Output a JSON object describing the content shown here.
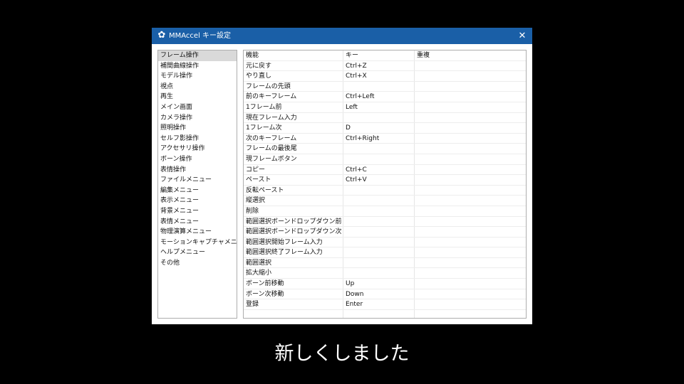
{
  "window": {
    "title": "MMAccel キー設定",
    "icon": "gear-icon",
    "close_label": "✕",
    "accent_color": "#1a5fa7"
  },
  "categories": {
    "selected_index": 0,
    "items": [
      "フレーム操作",
      "補間曲線操作",
      "モデル操作",
      "視点",
      "再生",
      "メイン画面",
      "カメラ操作",
      "照明操作",
      "セルフ影操作",
      "アクセサリ操作",
      "ボーン操作",
      "表情操作",
      "ファイルメニュー",
      "編集メニュー",
      "表示メニュー",
      "背景メニュー",
      "表情メニュー",
      "物理演算メニュー",
      "モーションキャプチャメニュー",
      "ヘルプメニュー",
      "その他"
    ]
  },
  "table": {
    "headers": {
      "function": "機能",
      "key": "キー",
      "duplicate": "重複"
    },
    "rows": [
      {
        "function": "元に戻す",
        "key": "Ctrl+Z",
        "duplicate": ""
      },
      {
        "function": "やり直し",
        "key": "Ctrl+X",
        "duplicate": ""
      },
      {
        "function": "フレームの先頭",
        "key": "",
        "duplicate": ""
      },
      {
        "function": "前のキーフレーム",
        "key": "Ctrl+Left",
        "duplicate": ""
      },
      {
        "function": "1フレーム前",
        "key": "Left",
        "duplicate": ""
      },
      {
        "function": "現在フレーム入力",
        "key": "",
        "duplicate": ""
      },
      {
        "function": "1フレーム次",
        "key": "D",
        "duplicate": ""
      },
      {
        "function": "次のキーフレーム",
        "key": "Ctrl+Right",
        "duplicate": ""
      },
      {
        "function": "フレームの最後尾",
        "key": "",
        "duplicate": ""
      },
      {
        "function": "現フレームボタン",
        "key": "",
        "duplicate": ""
      },
      {
        "function": "コピー",
        "key": "Ctrl+C",
        "duplicate": ""
      },
      {
        "function": "ペースト",
        "key": "Ctrl+V",
        "duplicate": ""
      },
      {
        "function": "反転ペースト",
        "key": "",
        "duplicate": ""
      },
      {
        "function": "縦選択",
        "key": "",
        "duplicate": ""
      },
      {
        "function": "削除",
        "key": "",
        "duplicate": ""
      },
      {
        "function": "範囲選択ボーンドロップダウン前項目",
        "key": "",
        "duplicate": ""
      },
      {
        "function": "範囲選択ボーンドロップダウン次項目",
        "key": "",
        "duplicate": ""
      },
      {
        "function": "範囲選択開始フレーム入力",
        "key": "",
        "duplicate": ""
      },
      {
        "function": "範囲選択終了フレーム入力",
        "key": "",
        "duplicate": ""
      },
      {
        "function": "範囲選択",
        "key": "",
        "duplicate": ""
      },
      {
        "function": "拡大縮小",
        "key": "",
        "duplicate": ""
      },
      {
        "function": "ボーン前移動",
        "key": "Up",
        "duplicate": ""
      },
      {
        "function": "ボーン次移動",
        "key": "Down",
        "duplicate": ""
      },
      {
        "function": "登録",
        "key": "Enter",
        "duplicate": ""
      }
    ]
  },
  "subtitle": "新しくしました"
}
